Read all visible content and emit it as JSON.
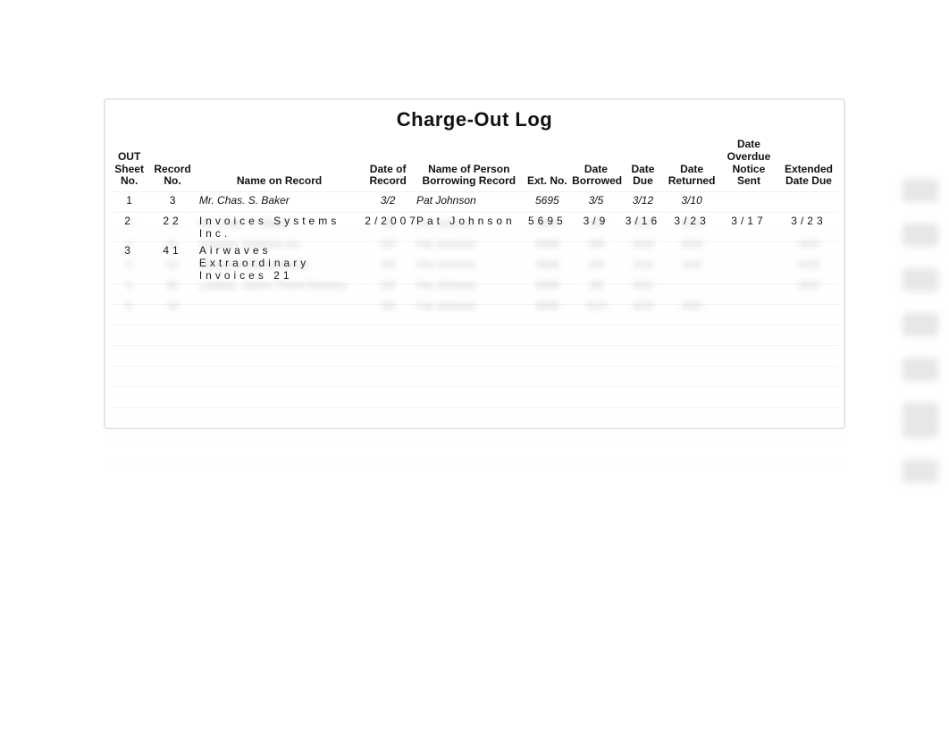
{
  "title": "Charge-Out Log",
  "columns": {
    "out": "OUT Sheet No.",
    "rec": "Record No.",
    "name": "Name on Record",
    "dor": "Date of Record",
    "borrower": "Name of Person Borrowing Record",
    "ext": "Ext. No.",
    "dborrowed": "Date Borrowed",
    "due": "Date Due",
    "returned": "Date Returned",
    "overdue": "Date Overdue Notice Sent",
    "extdue": "Extended Date Due"
  },
  "chart_data": {
    "type": "table",
    "title": "Charge-Out Log",
    "columns": [
      "OUT Sheet No.",
      "Record No.",
      "Name on Record",
      "Date of Record",
      "Name of Person Borrowing Record",
      "Ext. No.",
      "Date Borrowed",
      "Date Due",
      "Date Returned",
      "Date Overdue Notice Sent",
      "Extended Date Due"
    ],
    "rows": [
      {
        "out": "1",
        "rec": "3",
        "name": "Mr. Chas. S. Baker",
        "dor": "3/2",
        "borrower": "Pat Johnson",
        "ext": "5695",
        "dborrowed": "3/5",
        "due": "3/12",
        "returned": "3/10",
        "overdue": "",
        "extdue": ""
      },
      {
        "out": "2",
        "rec": "22",
        "name": "Invoices Systems Inc.",
        "dor": "2/2007",
        "borrower": "Pat Johnson",
        "ext": "5695",
        "dborrowed": "3/9",
        "due": "3/16",
        "returned": "3/23",
        "overdue": "3/17",
        "extdue": "3/23"
      },
      {
        "out": "3",
        "rec": "41",
        "name": "Airwaves Extraordinary Invoices 21",
        "dor": "",
        "borrower": "",
        "ext": "",
        "dborrowed": "",
        "due": "",
        "returned": "",
        "overdue": "",
        "extdue": ""
      }
    ]
  },
  "rows": [
    {
      "kind": "sharp",
      "out": "1",
      "rec": "3",
      "name": "Mr. Chas. S. Baker",
      "dor": "3/2",
      "borrower": "Pat Johnson",
      "ext": "5695",
      "dborrowed": "3/5",
      "due": "3/12",
      "returned": "3/10",
      "overdue": "",
      "extdue": ""
    },
    {
      "kind": "wide",
      "out": "2",
      "rec": "22",
      "name": "Invoices Systems Inc.",
      "dor": "2/2007",
      "borrower": "Pat Johnson",
      "ext": "5695",
      "dborrowed": "3/9",
      "due": "3/16",
      "returned": "3/23",
      "overdue": "3/17",
      "extdue": "3/23"
    },
    {
      "kind": "wide",
      "out": "3",
      "rec": "41",
      "name": "Airwaves Extraordinary Invoices 21",
      "dor": "",
      "borrower": "",
      "ext": "",
      "dborrowed": "",
      "due": "",
      "returned": "",
      "overdue": "",
      "extdue": ""
    }
  ],
  "ghostRows": [
    {
      "out": "1",
      "rec": "3",
      "name": "Mr. Chas. S. Baker",
      "dor": "3/2",
      "borrower": "Pat Johnson",
      "ext": "5695",
      "dborrowed": "3/5",
      "due": "3/12",
      "returned": "3/10",
      "overdue": "",
      "extdue": ""
    },
    {
      "out": "2",
      "rec": "22",
      "name": "Invoices Systems Inc.",
      "dor": "3/2",
      "borrower": "Pat Johnson",
      "ext": "5695",
      "dborrowed": "3/9",
      "due": "3/16",
      "returned": "3/23",
      "overdue": "",
      "extdue": "3/23"
    },
    {
      "out": "3",
      "rec": "41",
      "name": "Airwaves Extraordinary",
      "dor": "3/3",
      "borrower": "Pat Johnson",
      "ext": "5695",
      "dborrowed": "3/9",
      "due": "3/16",
      "returned": "3/16",
      "overdue": "",
      "extdue": "3/23"
    },
    {
      "out": "4",
      "rec": "50",
      "name": "Laidlaw, James Travel Itinerary",
      "dor": "3/4",
      "borrower": "Pat Johnson",
      "ext": "5695",
      "dborrowed": "3/9",
      "due": "3/16",
      "returned": "",
      "overdue": "",
      "extdue": "3/23"
    },
    {
      "out": "5",
      "rec": "18",
      "name": "",
      "dor": "3/5",
      "borrower": "Pat Johnson",
      "ext": "5695",
      "dborrowed": "3/12",
      "due": "3/19",
      "returned": "3/20",
      "overdue": "",
      "extdue": ""
    }
  ],
  "emptyRows": 7
}
